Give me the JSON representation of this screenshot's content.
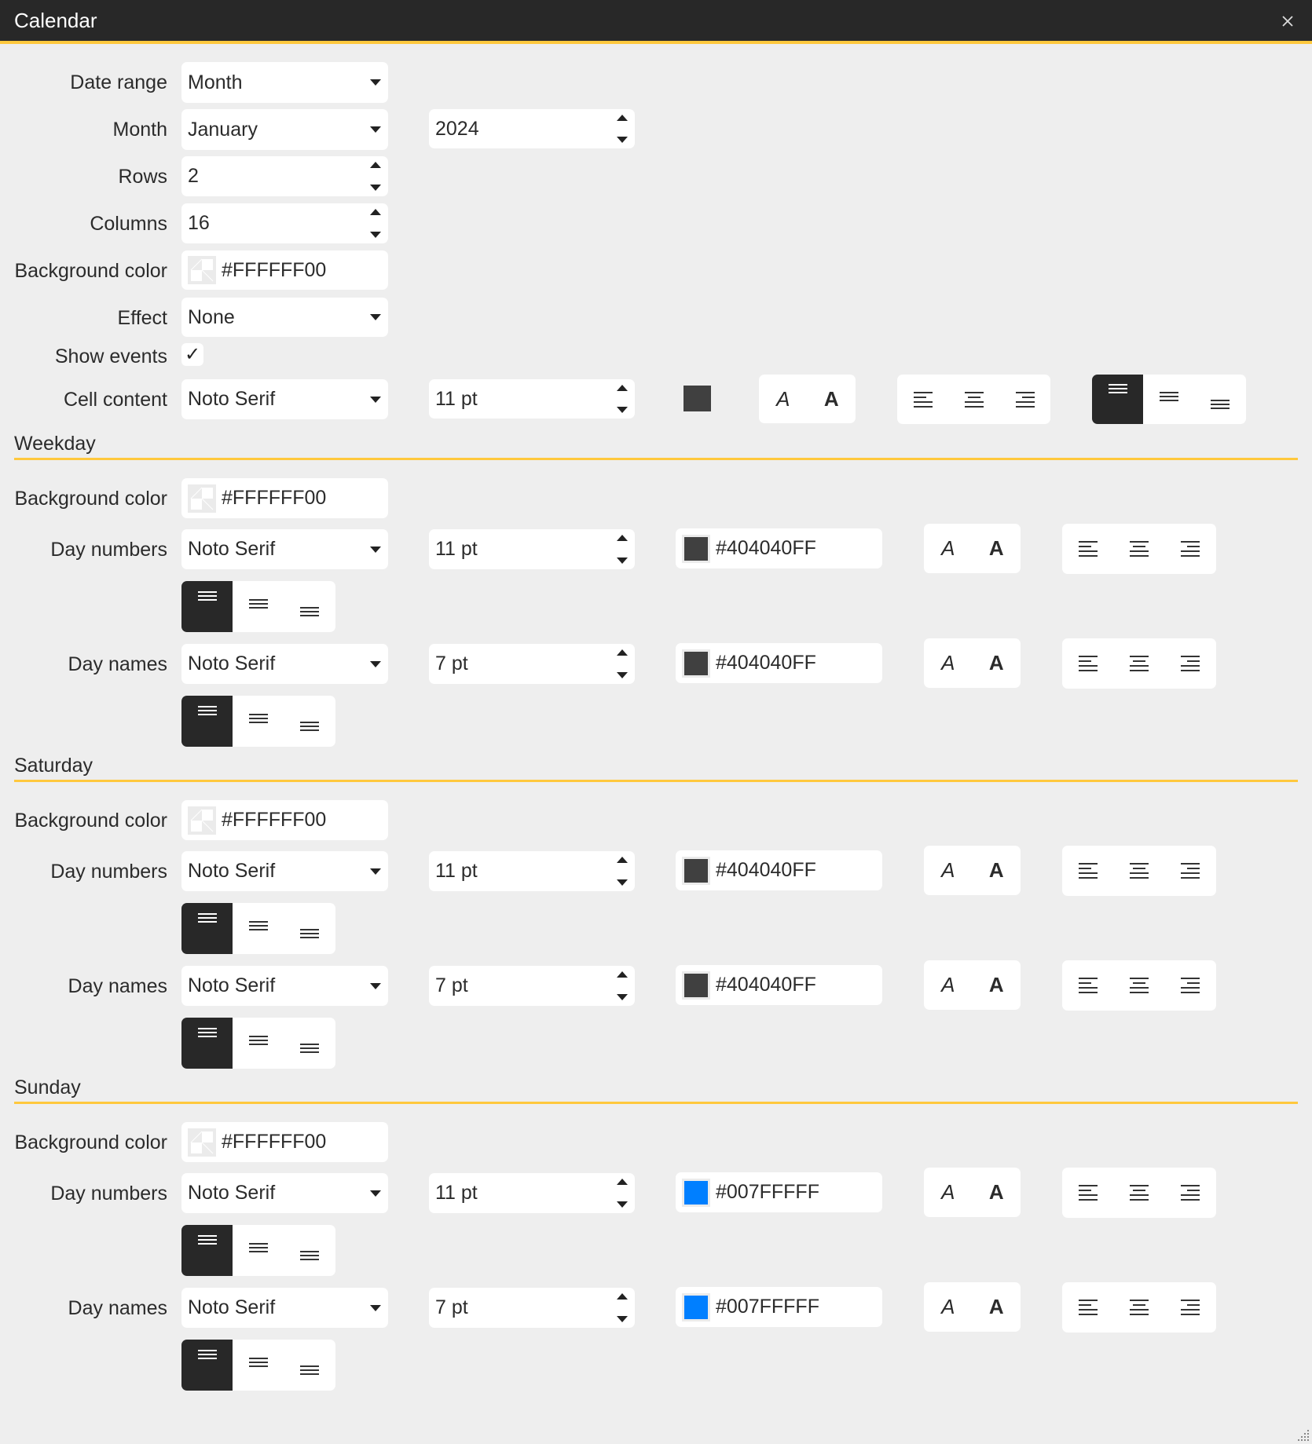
{
  "window": {
    "title": "Calendar",
    "close_icon": "close-icon",
    "accent_color": "#FFC83D"
  },
  "general": {
    "date_range": {
      "label": "Date range",
      "value": "Month"
    },
    "month": {
      "label": "Month",
      "value": "January",
      "year": "2024"
    },
    "rows": {
      "label": "Rows",
      "value": "2"
    },
    "columns": {
      "label": "Columns",
      "value": "16"
    },
    "background_color": {
      "label": "Background color",
      "value": "#FFFFFF00"
    },
    "effect": {
      "label": "Effect",
      "value": "None"
    },
    "show_events": {
      "label": "Show events",
      "checked": true,
      "check_glyph": "✓"
    },
    "cell_content": {
      "label": "Cell content",
      "font": "Noto Serif",
      "size": "11 pt",
      "color": "#404040",
      "italic_glyph": "A",
      "bold_glyph": "A",
      "italic": false,
      "bold": false,
      "h_align": null,
      "v_align": "top"
    }
  },
  "sections": [
    {
      "title": "Weekday",
      "background_color": {
        "label": "Background color",
        "value": "#FFFFFF00"
      },
      "day_numbers": {
        "label": "Day numbers",
        "font": "Noto Serif",
        "size": "11 pt",
        "color": "#404040FF",
        "swatch": "#404040",
        "italic_glyph": "A",
        "bold_glyph": "A",
        "v_align": "top"
      },
      "day_names": {
        "label": "Day names",
        "font": "Noto Serif",
        "size": "7 pt",
        "color": "#404040FF",
        "swatch": "#404040",
        "italic_glyph": "A",
        "bold_glyph": "A",
        "v_align": "top"
      }
    },
    {
      "title": "Saturday",
      "background_color": {
        "label": "Background color",
        "value": "#FFFFFF00"
      },
      "day_numbers": {
        "label": "Day numbers",
        "font": "Noto Serif",
        "size": "11 pt",
        "color": "#404040FF",
        "swatch": "#404040",
        "italic_glyph": "A",
        "bold_glyph": "A",
        "v_align": "top"
      },
      "day_names": {
        "label": "Day names",
        "font": "Noto Serif",
        "size": "7 pt",
        "color": "#404040FF",
        "swatch": "#404040",
        "italic_glyph": "A",
        "bold_glyph": "A",
        "v_align": "top"
      }
    },
    {
      "title": "Sunday",
      "background_color": {
        "label": "Background color",
        "value": "#FFFFFF00"
      },
      "day_numbers": {
        "label": "Day numbers",
        "font": "Noto Serif",
        "size": "11 pt",
        "color": "#007FFFFF",
        "swatch": "#007FFF",
        "italic_glyph": "A",
        "bold_glyph": "A",
        "v_align": "top"
      },
      "day_names": {
        "label": "Day names",
        "font": "Noto Serif",
        "size": "7 pt",
        "color": "#007FFFFF",
        "swatch": "#007FFF",
        "italic_glyph": "A",
        "bold_glyph": "A",
        "v_align": "top"
      }
    }
  ]
}
